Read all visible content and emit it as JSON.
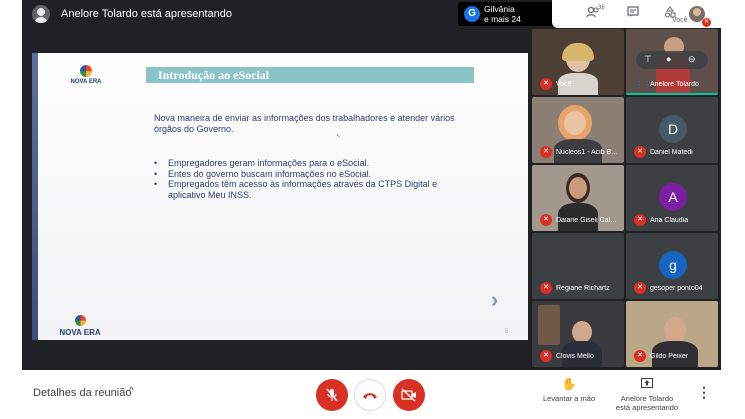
{
  "topbar": {
    "presenter_text": "Anelore Tolardo está apresentando",
    "chip_avatar_letter": "G",
    "chip_line1": "Gilvânia",
    "chip_line2": "e mais 24",
    "people_count": "36",
    "you_label": "Você",
    "icons": [
      "people-icon",
      "chat-icon",
      "activities-icon"
    ]
  },
  "slide": {
    "logo_top": "NOVA ERA",
    "title": "Introdução ao eSocial",
    "intro": "Nova maneira de enviar as informações dos trabalhadores e atender vários órgãos do Governo.",
    "bullets": [
      "Empregadores geram informações para o eSocial.",
      "Entes do governo buscam informações no eSocial.",
      "Empregados têm acesso às informações através da CTPS Digital e aplicativo Meu INSS."
    ],
    "next_arrow": "›",
    "page_number": "5",
    "logo_bottom": "NOVA ERA"
  },
  "participants": [
    {
      "name": "Você",
      "type": "photo",
      "muted": true
    },
    {
      "name": "Anelore Tolardo",
      "type": "photo",
      "muted": false,
      "speaking": true
    },
    {
      "name": "Nucleos1 - Acib B...",
      "type": "photo",
      "muted": true
    },
    {
      "name": "Daniel Matedi",
      "type": "letter",
      "letter": "D",
      "color": "#455a64",
      "muted": true
    },
    {
      "name": "Daiane Giseli Cat...",
      "type": "photo",
      "muted": true
    },
    {
      "name": "Ana Claudia",
      "type": "letter",
      "letter": "A",
      "color": "#7b1fa2",
      "muted": true
    },
    {
      "name": "Regiane Richartz",
      "type": "blank",
      "muted": true
    },
    {
      "name": "gesoper ponto04",
      "type": "letter",
      "letter": "g",
      "color": "#1565c0",
      "muted": true
    },
    {
      "name": "Clovis Mello",
      "type": "photo",
      "muted": true
    },
    {
      "name": "Gildo Peixer",
      "type": "photo",
      "muted": true
    }
  ],
  "bottombar": {
    "details_label": "Detalhes da reunião",
    "raise_hand_label": "Levantar a mão",
    "presenting_line1": "Anelore Tolardo",
    "presenting_line2": "está apresentando"
  },
  "colors": {
    "stage": "#202124",
    "danger": "#d93025",
    "slide_title_bar": "#8bc4c6",
    "slide_text": "#2c3e78"
  }
}
